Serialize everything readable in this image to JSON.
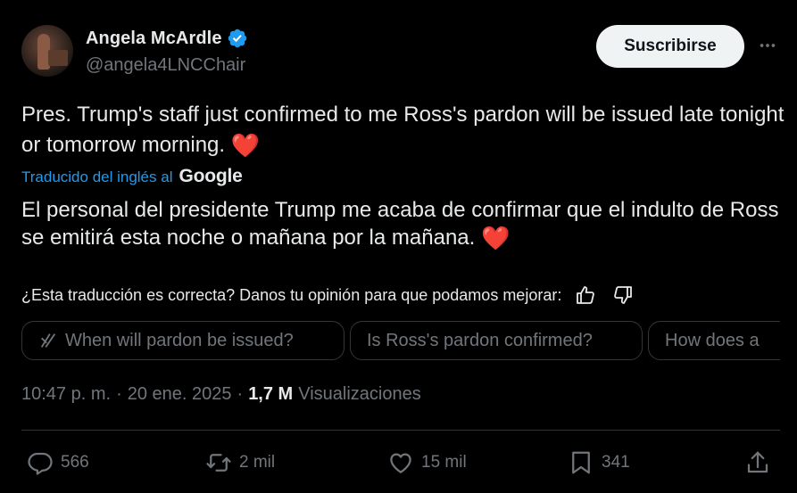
{
  "author": {
    "name": "Angela McArdle",
    "handle": "@angela4LNCChair",
    "verified": true
  },
  "subscribe_label": "Suscribirse",
  "tweet": {
    "text": "Pres. Trump's staff just confirmed to me Ross's pardon will be issued late tonight or tomorrow morning.",
    "emoji": "❤️"
  },
  "translation": {
    "label": "Traducido del inglés al",
    "provider": "Google",
    "text": "El personal del presidente Trump me acaba de confirmar que el indulto de Ross se emitirá esta noche o mañana por la mañana.",
    "emoji": "❤️",
    "feedback_prompt": "¿Esta traducción es correcta? Danos tu opinión para que podamos mejorar:"
  },
  "grok_suggestions": [
    "When will pardon be issued?",
    "Is Ross's pardon confirmed?",
    "How does a"
  ],
  "meta": {
    "time": "10:47 p. m.",
    "separator": "·",
    "date": "20 ene. 2025",
    "views_count": "1,7 M",
    "views_label": "Visualizaciones"
  },
  "actions": {
    "replies": "566",
    "reposts": "2 mil",
    "likes": "15 mil",
    "bookmarks": "341"
  },
  "colors": {
    "background": "#000000",
    "text": "#e7e9ea",
    "muted": "#71767b",
    "link": "#1d9bf0",
    "verified": "#1d9bf0",
    "heart": "#e0245e"
  }
}
